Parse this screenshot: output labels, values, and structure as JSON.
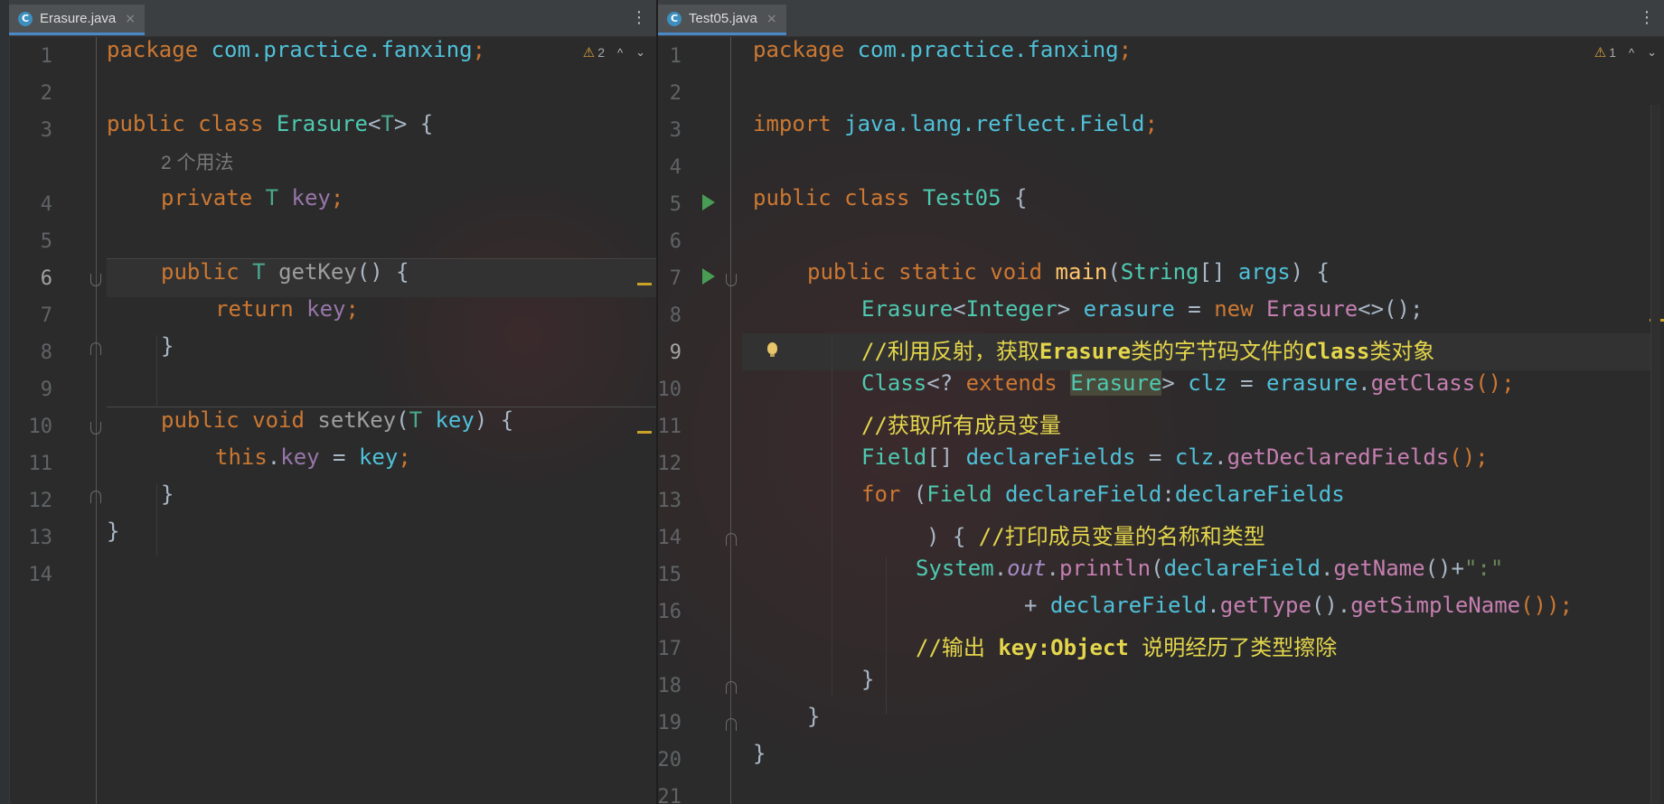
{
  "colors": {
    "tab_accent": "#4a88c7",
    "warning": "#e0a43a",
    "run": "#499c54",
    "bulb": "#e8c46a",
    "keyword": "#cc7832",
    "comment": "#e4d64b"
  },
  "left_pane": {
    "tab": {
      "file_icon": "C",
      "label": "Erasure.java",
      "close": "×"
    },
    "menu_icon": "⋮",
    "warnings": {
      "icon": "⚠",
      "count": "2",
      "prev": "^",
      "next": "⌄"
    },
    "line_numbers": [
      "1",
      "2",
      "3",
      "4",
      "5",
      "6",
      "7",
      "8",
      "9",
      "10",
      "11",
      "12",
      "13",
      "14"
    ],
    "usage_hint": "2 个用法",
    "code": {
      "l1": [
        "package",
        "com.practice.fanxing",
        ";"
      ],
      "l3": [
        "public class",
        "Erasure",
        "<",
        "T",
        "> {"
      ],
      "l4": [
        "private",
        "T",
        "key",
        ";"
      ],
      "l6": [
        "public",
        "T",
        "getKey",
        "() {"
      ],
      "l7": [
        "return",
        "key",
        ";"
      ],
      "l8": [
        "}"
      ],
      "l10": [
        "public void",
        "setKey",
        "(",
        "T",
        "key",
        ") {"
      ],
      "l11": [
        "this",
        ".",
        "key",
        " = ",
        "key",
        ";"
      ],
      "l12": [
        "}"
      ],
      "l13": [
        "}"
      ]
    }
  },
  "right_pane": {
    "tab": {
      "file_icon": "C",
      "label": "Test05.java",
      "close": "×"
    },
    "menu_icon": "⋮",
    "warnings": {
      "icon": "⚠",
      "count": "1",
      "prev": "^",
      "next": "⌄"
    },
    "line_numbers": [
      "1",
      "2",
      "3",
      "4",
      "5",
      "6",
      "7",
      "8",
      "9",
      "10",
      "11",
      "12",
      "13",
      "14",
      "15",
      "16",
      "17",
      "18",
      "19",
      "20",
      "21"
    ],
    "code": {
      "l1": [
        "package",
        "com.practice.fanxing",
        ";"
      ],
      "l3": [
        "import",
        "java.lang.reflect.Field",
        ";"
      ],
      "l5": [
        "public class",
        "Test05",
        " {"
      ],
      "l7": [
        "public static void",
        "main",
        "(",
        "String",
        "[] ",
        "args",
        ") {"
      ],
      "l8": [
        "Erasure",
        "<",
        "Integer",
        "> ",
        "erasure",
        " = ",
        "new",
        "Erasure",
        "<>();"
      ],
      "l9": [
        "//利用反射，获取",
        "Erasure",
        "类的字节码文件的",
        "Class",
        "类对象"
      ],
      "l10": [
        "Class",
        "<? ",
        "extends",
        "Erasure",
        "> ",
        "clz",
        " = ",
        "erasure",
        ".",
        "getClass",
        "();"
      ],
      "l11": [
        "//获取所有成员变量"
      ],
      "l12": [
        "Field",
        "[] ",
        "declareFields",
        " = ",
        "clz",
        ".",
        "getDeclaredFields",
        "();"
      ],
      "l13": [
        "for",
        " (",
        "Field",
        " ",
        "declareField",
        ":",
        "declareFields"
      ],
      "l14": [
        ") { ",
        "//打印成员变量的名称和类型"
      ],
      "l15": [
        "System",
        ".",
        "out",
        ".",
        "println",
        "(",
        "declareField",
        ".",
        "getName",
        "()+",
        "\":\""
      ],
      "l16": [
        "+ ",
        "declareField",
        ".",
        "getType",
        "().",
        "getSimpleName",
        "());"
      ],
      "l17": [
        "//输出 ",
        "key:Object",
        " 说明经历了类型擦除"
      ],
      "l18": [
        "}"
      ],
      "l19": [
        "}"
      ],
      "l20": [
        "}"
      ]
    }
  }
}
